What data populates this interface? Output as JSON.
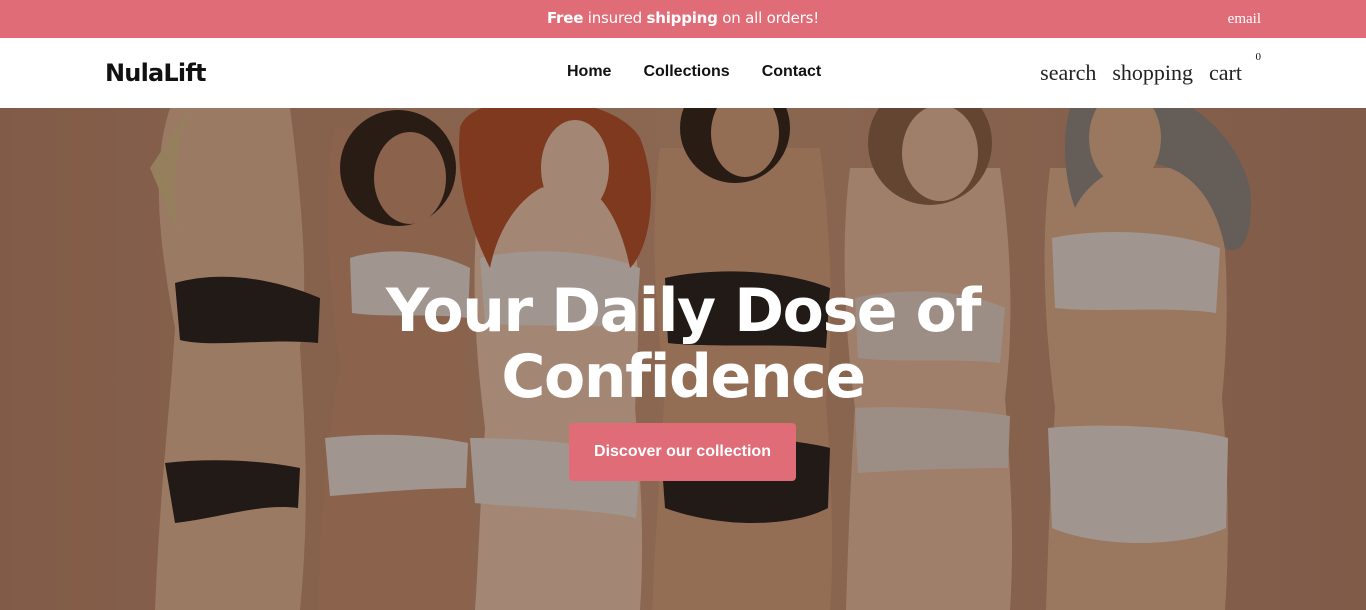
{
  "announcement": {
    "part1_bold": "Free",
    "part2": " insured ",
    "part3_bold": "shipping",
    "part4": " on all orders!",
    "email_label": "email"
  },
  "header": {
    "logo": "NulaLift",
    "nav": [
      {
        "label": "Home"
      },
      {
        "label": "Collections"
      },
      {
        "label": "Contact"
      }
    ],
    "actions": {
      "search_label": "search",
      "shopping_label": "shopping",
      "cart_label": "cart",
      "cart_count": "0"
    }
  },
  "hero": {
    "title_line1": "Your Daily Dose of",
    "title_line2": "Confidence",
    "cta_label": "Discover our collection"
  },
  "colors": {
    "accent": "#e06c78",
    "hero_background": "#c99a7c"
  }
}
